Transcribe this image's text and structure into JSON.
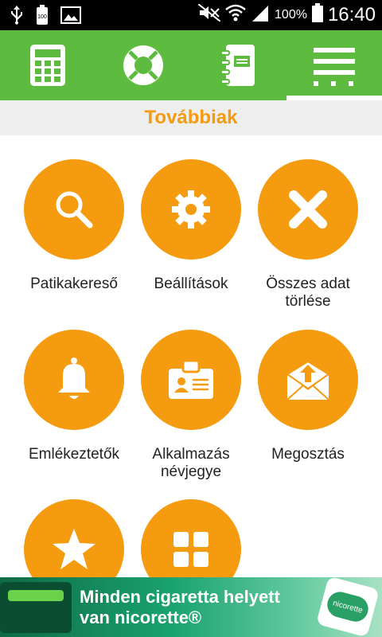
{
  "status_bar": {
    "battery_percent": "100%",
    "time": "16:40",
    "battery_badge": "100"
  },
  "toolbar": {
    "tabs": [
      {
        "icon": "calculator-icon"
      },
      {
        "icon": "lifebuoy-icon"
      },
      {
        "icon": "notebook-icon"
      },
      {
        "icon": "menu-more-icon",
        "active": true
      }
    ]
  },
  "section": {
    "title": "Továbbiak"
  },
  "tiles": [
    {
      "label": "Patikakereső",
      "icon": "search-icon"
    },
    {
      "label": "Beállítások",
      "icon": "gear-icon"
    },
    {
      "label": "Összes adat törlése",
      "icon": "close-icon"
    },
    {
      "label": "Emlékeztetők",
      "icon": "bell-icon"
    },
    {
      "label": "Alkalmazás névjegye",
      "icon": "id-card-icon"
    },
    {
      "label": "Megosztás",
      "icon": "share-mail-icon"
    },
    {
      "label": "",
      "icon": "star-icon"
    },
    {
      "label": "",
      "icon": "grid-icon"
    }
  ],
  "ad": {
    "line1": "Minden cigaretta helyett",
    "line2": "van nicorette®",
    "logo_text": "nicorette"
  },
  "colors": {
    "toolbar": "#5dbb3f",
    "accent": "#f59b10",
    "title": "#f49b12"
  }
}
